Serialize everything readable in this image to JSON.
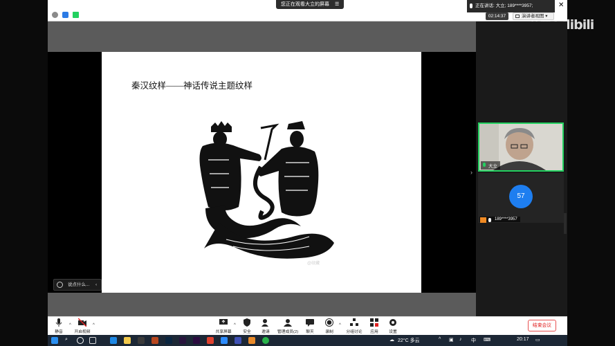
{
  "share_indicator": {
    "text": "您正在观看大立的屏幕",
    "menu": "☰"
  },
  "speaking": {
    "text": "正在讲话: 大立; 189****3957;"
  },
  "meeting_timer": "02:14:37",
  "view_button": "演讲者视图 ▾",
  "watermark": {
    "brand": "纹藏",
    "site": "bilibili"
  },
  "slide": {
    "title": "秦汉纹样——神话传说主题纹样",
    "image_watermark": "@纹藏"
  },
  "participants": [
    {
      "name": "大立",
      "video": true
    },
    {
      "name": "189****3957",
      "avatar_text": "57"
    }
  ],
  "chat_hint": "说点什么...",
  "toolbar": {
    "mute": "静音",
    "video": "开启视频",
    "share": "共享屏幕",
    "security": "安全",
    "invite": "邀请",
    "manage": "管理成员(2)",
    "chat": "聊天",
    "record": "录制",
    "breakout": "分组讨论",
    "apps": "应用",
    "settings": "设置",
    "end": "结束会议"
  },
  "taskbar": {
    "weather": "22°C 多云",
    "input_mode": "中",
    "time": "20:17"
  },
  "colors": {
    "accent_green": "#23d160",
    "avatar_blue": "#1e7ef0",
    "end_red": "#e02020"
  }
}
